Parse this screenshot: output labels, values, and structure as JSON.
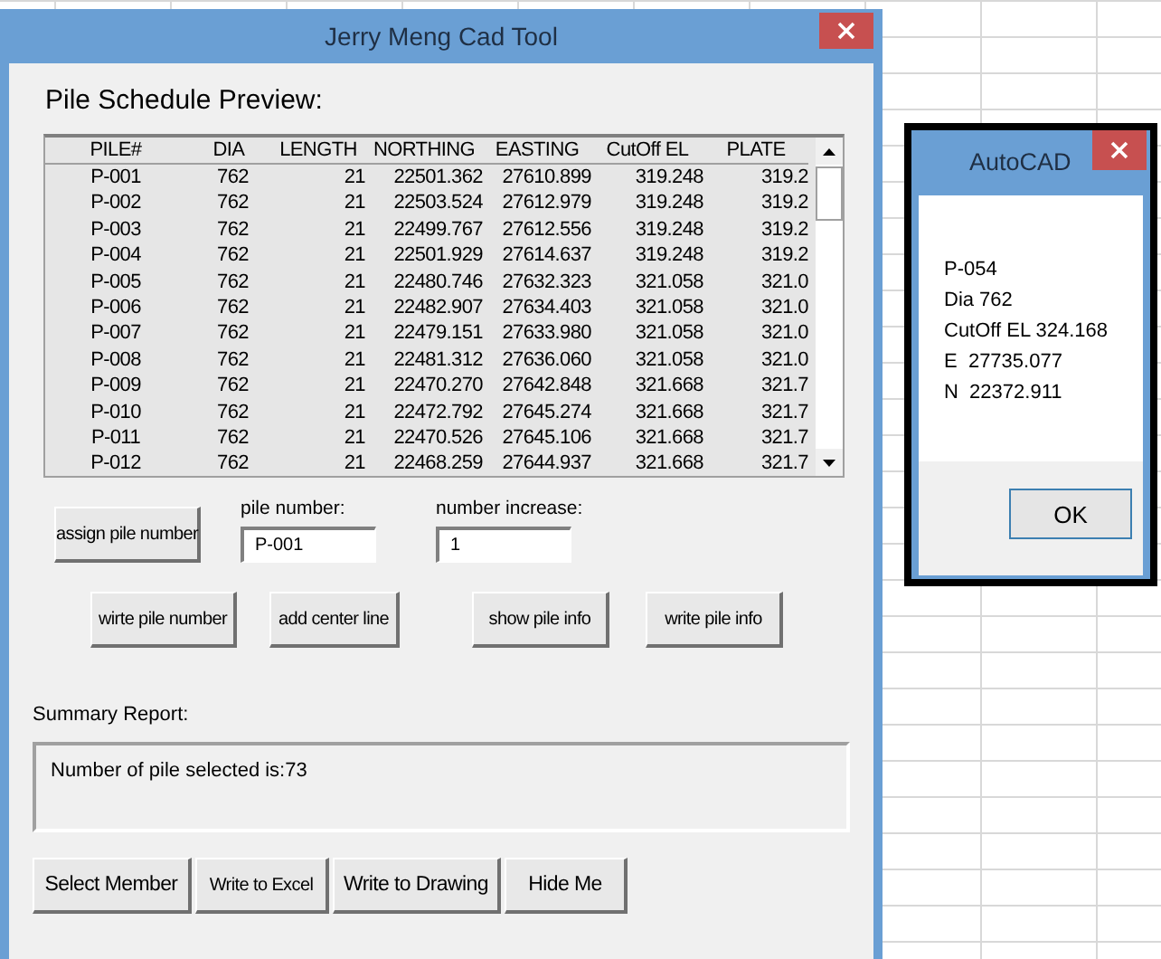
{
  "main_window": {
    "title": "Jerry Meng Cad Tool",
    "heading": "Pile Schedule Preview:",
    "table": {
      "columns": [
        "PILE#",
        "DIA",
        "LENGTH",
        "NORTHING",
        "EASTING",
        "CutOff EL",
        "PLATE"
      ],
      "rows": [
        [
          "P-001",
          "762",
          "21",
          "22501.362",
          "27610.899",
          "319.248",
          "319.2"
        ],
        [
          "P-002",
          "762",
          "21",
          "22503.524",
          "27612.979",
          "319.248",
          "319.2"
        ],
        [
          "P-003",
          "762",
          "21",
          "22499.767",
          "27612.556",
          "319.248",
          "319.2"
        ],
        [
          "P-004",
          "762",
          "21",
          "22501.929",
          "27614.637",
          "319.248",
          "319.2"
        ],
        [
          "P-005",
          "762",
          "21",
          "22480.746",
          "27632.323",
          "321.058",
          "321.0"
        ],
        [
          "P-006",
          "762",
          "21",
          "22482.907",
          "27634.403",
          "321.058",
          "321.0"
        ],
        [
          "P-007",
          "762",
          "21",
          "22479.151",
          "27633.980",
          "321.058",
          "321.0"
        ],
        [
          "P-008",
          "762",
          "21",
          "22481.312",
          "27636.060",
          "321.058",
          "321.0"
        ],
        [
          "P-009",
          "762",
          "21",
          "22470.270",
          "27642.848",
          "321.668",
          "321.7"
        ],
        [
          "P-010",
          "762",
          "21",
          "22472.792",
          "27645.274",
          "321.668",
          "321.7"
        ],
        [
          "P-011",
          "762",
          "21",
          "22470.526",
          "27645.106",
          "321.668",
          "321.7"
        ],
        [
          "P-012",
          "762",
          "21",
          "22468.259",
          "27644.937",
          "321.668",
          "321.7"
        ]
      ]
    },
    "assign_button": "assign pile number",
    "pile_number": {
      "label": "pile number:",
      "value": "P-001"
    },
    "number_increase": {
      "label": "number increase:",
      "value": "1"
    },
    "action_buttons": [
      "wirte pile number",
      "add center line",
      "show pile info",
      "write pile info"
    ],
    "summary": {
      "label": "Summary Report:",
      "text": "Number of pile selected is:73"
    },
    "bottom_buttons": [
      "Select Member",
      "Write to Excel",
      "Write to Drawing",
      "Hide Me"
    ]
  },
  "dialog": {
    "title": "AutoCAD",
    "lines": [
      "P-054",
      "Dia 762",
      "CutOff EL 324.168",
      "E  27735.077",
      "N  22372.911"
    ],
    "button": "OK"
  }
}
